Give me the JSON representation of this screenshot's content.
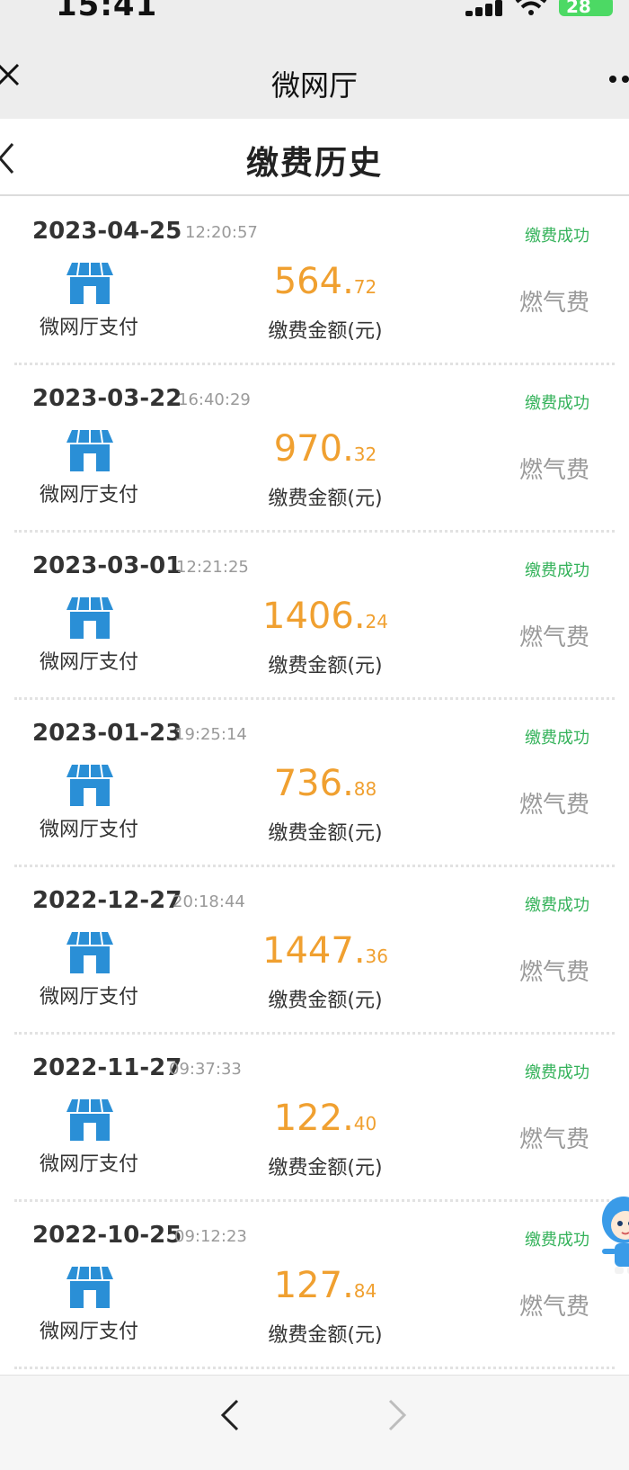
{
  "status_bar": {
    "time": "15:41",
    "battery": "28"
  },
  "wechat_bar": {
    "title": "微网厅"
  },
  "page": {
    "title": "缴费历史"
  },
  "records": [
    {
      "date": "2023-04-25",
      "time": "12:20:57",
      "status": "缴费成功",
      "channel": "微网厅支付",
      "amount_int": "564.",
      "amount_dec": "72",
      "amount_label": "缴费金额(元)",
      "type": "燃气费"
    },
    {
      "date": "2023-03-22",
      "time": "16:40:29",
      "status": "缴费成功",
      "channel": "微网厅支付",
      "amount_int": "970.",
      "amount_dec": "32",
      "amount_label": "缴费金额(元)",
      "type": "燃气费"
    },
    {
      "date": "2023-03-01",
      "time": "12:21:25",
      "status": "缴费成功",
      "channel": "微网厅支付",
      "amount_int": "1406.",
      "amount_dec": "24",
      "amount_label": "缴费金额(元)",
      "type": "燃气费"
    },
    {
      "date": "2023-01-23",
      "time": "19:25:14",
      "status": "缴费成功",
      "channel": "微网厅支付",
      "amount_int": "736.",
      "amount_dec": "88",
      "amount_label": "缴费金额(元)",
      "type": "燃气费"
    },
    {
      "date": "2022-12-27",
      "time": "20:18:44",
      "status": "缴费成功",
      "channel": "微网厅支付",
      "amount_int": "1447.",
      "amount_dec": "36",
      "amount_label": "缴费金额(元)",
      "type": "燃气费"
    },
    {
      "date": "2022-11-27",
      "time": "09:37:33",
      "status": "缴费成功",
      "channel": "微网厅支付",
      "amount_int": "122.",
      "amount_dec": "40",
      "amount_label": "缴费金额(元)",
      "type": "燃气费"
    },
    {
      "date": "2022-10-25",
      "time": "09:12:23",
      "status": "缴费成功",
      "channel": "微网厅支付",
      "amount_int": "127.",
      "amount_dec": "84",
      "amount_label": "缴费金额(元)",
      "type": "燃气费"
    }
  ],
  "icons": {
    "shop": "shop-icon",
    "back": "back-icon",
    "close": "close-icon",
    "more": "more-icon",
    "mascot": "mascot-icon"
  },
  "colors": {
    "status_success": "#34b25a",
    "amount": "#f0a030",
    "shop_icon": "#2a8fd6"
  }
}
